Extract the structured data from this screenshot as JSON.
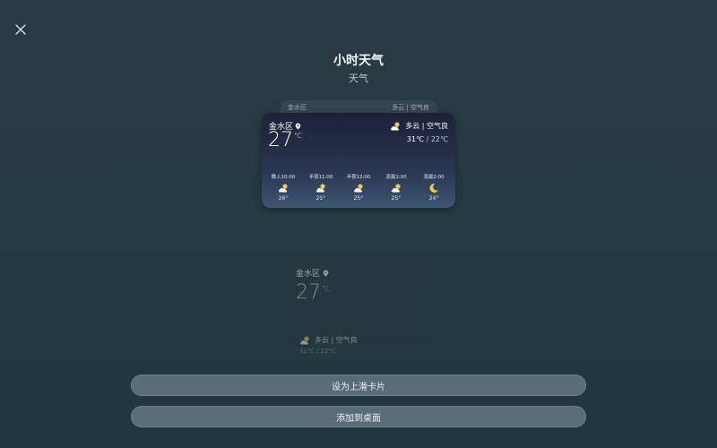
{
  "header": {
    "title": "小时天气",
    "subtitle": "天气"
  },
  "peek_card": {
    "location": "金水区",
    "condition": "多云 | 空气良"
  },
  "widget": {
    "location": "金水区",
    "temperature": "27",
    "unit": "℃",
    "condition": "多云 | 空气良",
    "high": "31℃",
    "low": "22℃",
    "range_separator": "/",
    "hours": [
      {
        "label": "晚上10:00",
        "icon": "cloudy-night-icon",
        "temp": "26°"
      },
      {
        "label": "半夜11:00",
        "icon": "cloudy-night-icon",
        "temp": "25°"
      },
      {
        "label": "半夜12:00",
        "icon": "cloudy-night-icon",
        "temp": "25°"
      },
      {
        "label": "凌晨1:00",
        "icon": "cloudy-night-icon",
        "temp": "25°"
      },
      {
        "label": "凌晨2:00",
        "icon": "moon-icon",
        "temp": "24°"
      }
    ]
  },
  "preview": {
    "location": "金水区",
    "temperature": "27",
    "unit": "℃",
    "condition": "多云 | 空气良",
    "range": "31℃ / 22℃"
  },
  "buttons": {
    "set_swipe_card": "设为上滑卡片",
    "add_to_desktop": "添加到桌面"
  },
  "colors": {
    "background": "#263a42",
    "widget_top": "#1d2038",
    "widget_bottom": "#3d5573",
    "button": "#5a6c76",
    "moon": "#f2c94c"
  }
}
